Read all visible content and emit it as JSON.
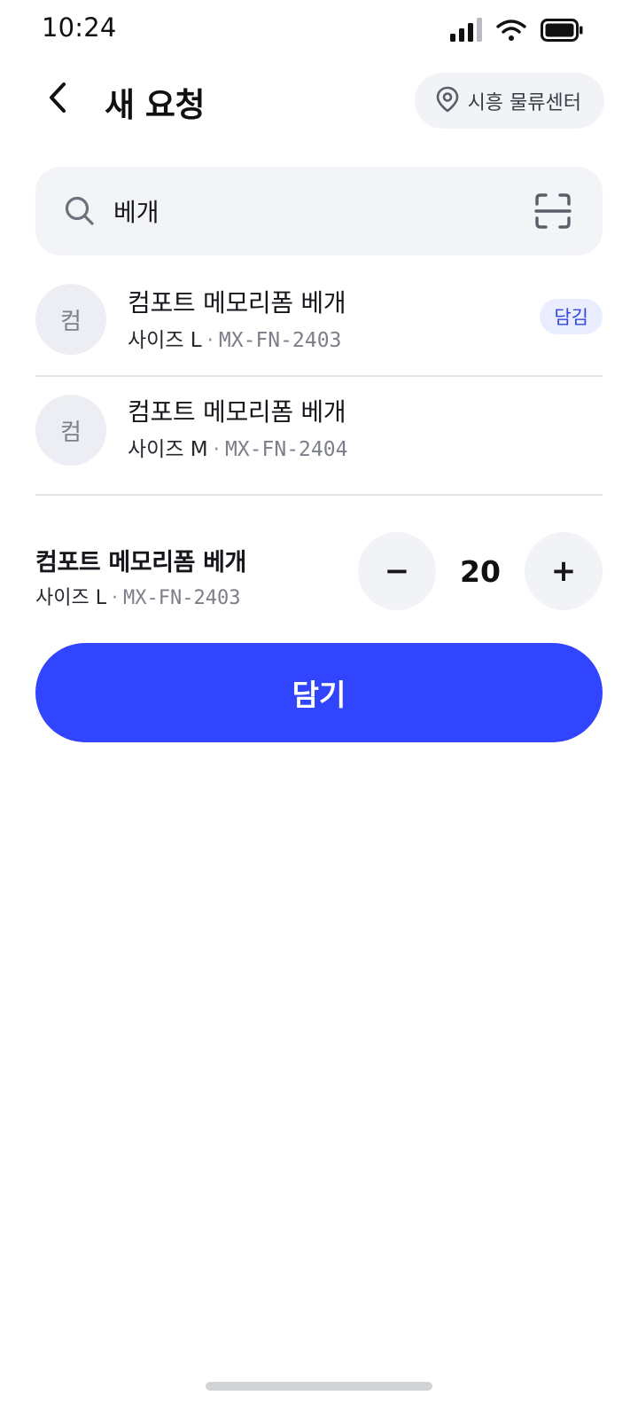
{
  "status_bar": {
    "time": "10:24"
  },
  "header": {
    "title": "새 요청",
    "location": "시흥 물류센터"
  },
  "search": {
    "value": "베개"
  },
  "results": [
    {
      "thumb_text": "컴",
      "name": "컴포트 메모리폼 베개",
      "size": "사이즈 L",
      "separator": "·",
      "sku": "MX-FN-2403",
      "badge": "담김"
    },
    {
      "thumb_text": "컴",
      "name": "컴포트 메모리폼 베개",
      "size": "사이즈 M",
      "separator": "·",
      "sku": "MX-FN-2404"
    }
  ],
  "selected": {
    "name": "컴포트 메모리폼 베개",
    "size": "사이즈 L",
    "separator": "·",
    "sku": "MX-FN-2403",
    "quantity": "20",
    "minus_label": "−",
    "plus_label": "+"
  },
  "actions": {
    "add_label": "담기"
  },
  "colors": {
    "accent": "#3145FF",
    "badge_bg": "#E9EDFF",
    "badge_text": "#3146E6",
    "surface": "#F3F4F8"
  },
  "icons": {
    "back": "chevron-left-icon",
    "location": "map-pin-icon",
    "search": "search-icon",
    "scan": "barcode-scan-icon"
  }
}
